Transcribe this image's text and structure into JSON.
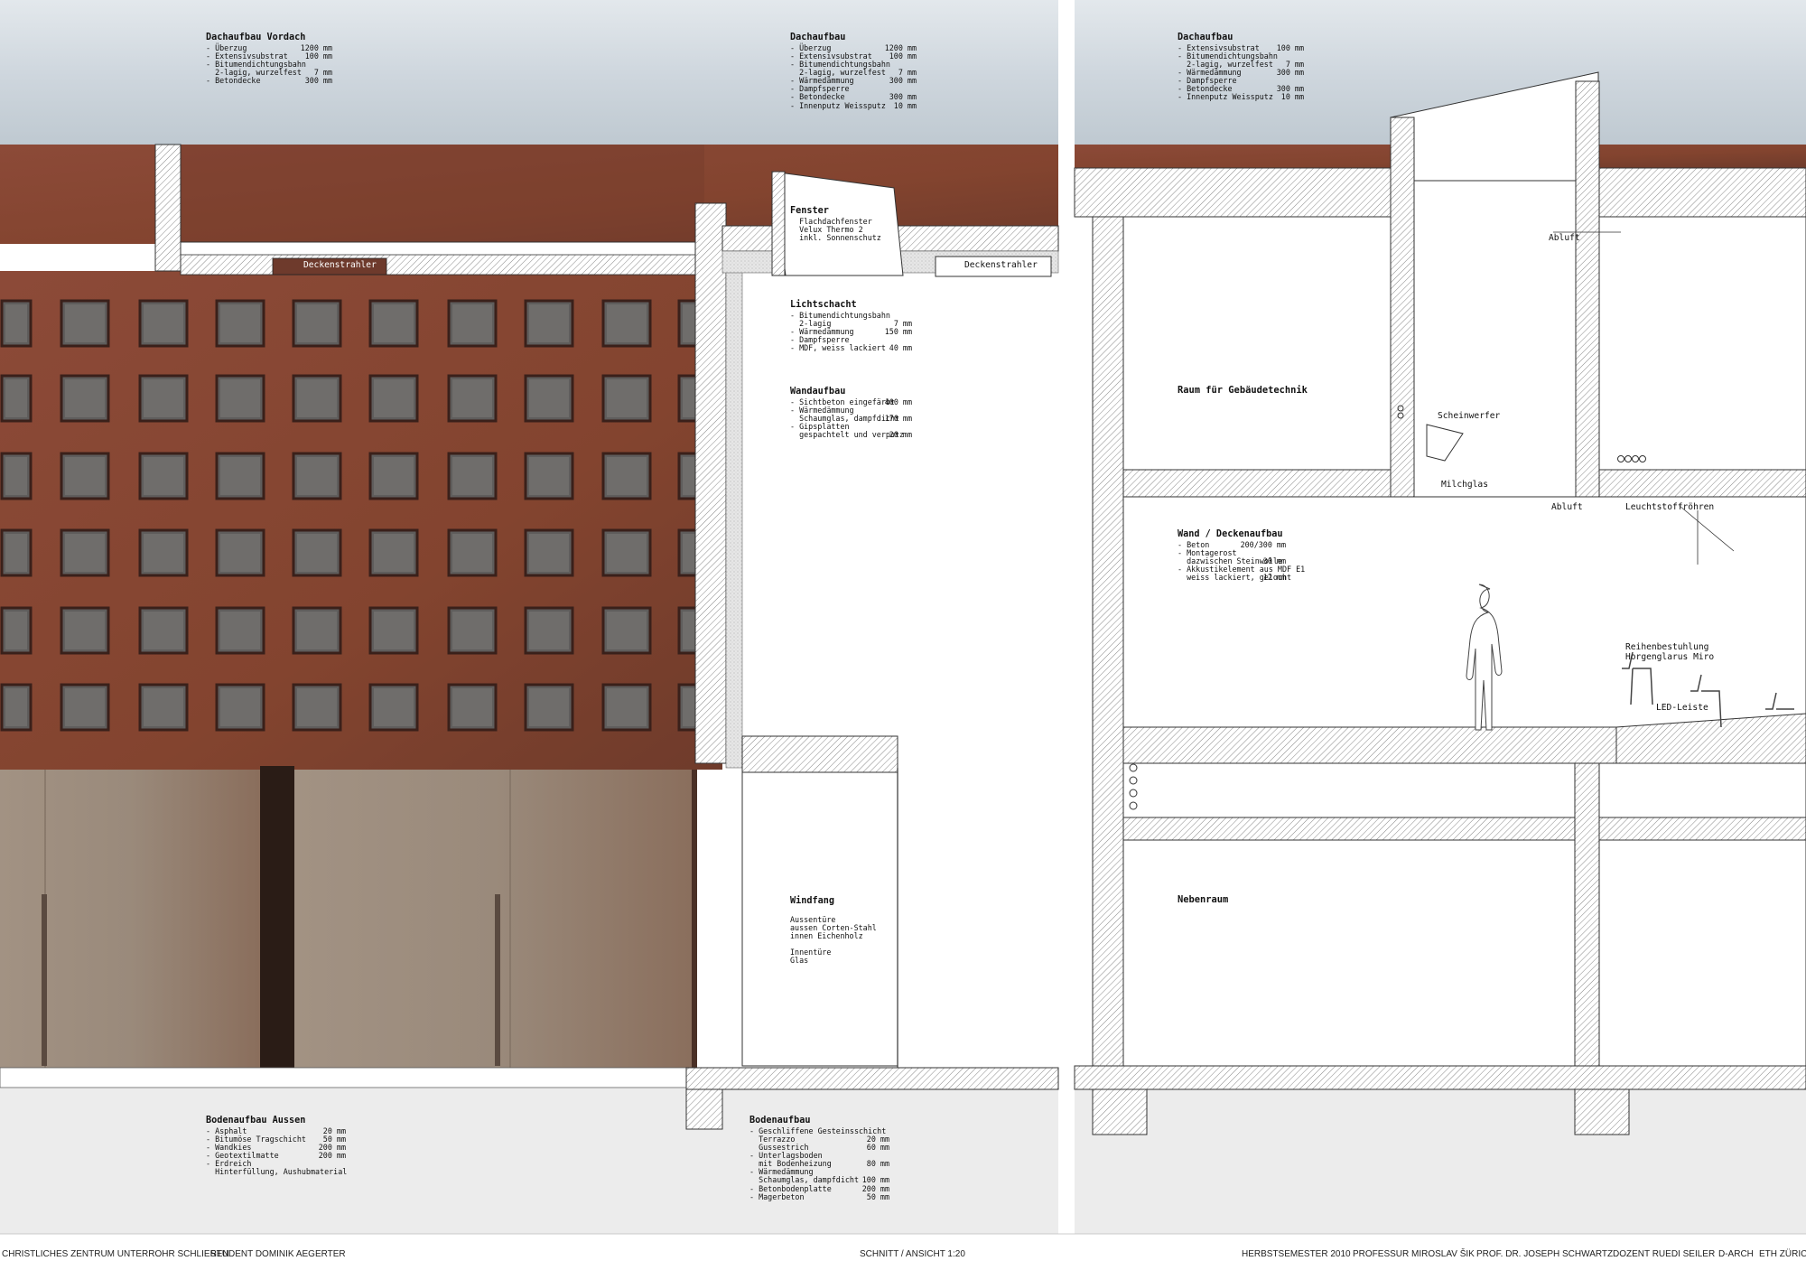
{
  "notes": {
    "dach_vordach": {
      "title": "Dachaufbau Vordach",
      "lines": [
        [
          "- Überzug",
          "1200 mm"
        ],
        [
          "- Extensivsubstrat",
          "100 mm"
        ],
        [
          "- Bitumendichtungsbahn",
          ""
        ],
        [
          "  2-lagig, wurzelfest",
          "7 mm"
        ],
        [
          "- Betondecke",
          "300 mm"
        ]
      ]
    },
    "dach_mitte": {
      "title": "Dachaufbau",
      "lines": [
        [
          "- Überzug",
          "1200 mm"
        ],
        [
          "- Extensivsubstrat",
          "100 mm"
        ],
        [
          "- Bitumendichtungsbahn",
          ""
        ],
        [
          "  2-lagig, wurzelfest",
          "7 mm"
        ],
        [
          "- Wärmedämmung",
          "300 mm"
        ],
        [
          "- Dampfsperre",
          ""
        ],
        [
          "- Betondecke",
          "300 mm"
        ],
        [
          "- Innenputz Weissputz",
          "10 mm"
        ]
      ]
    },
    "dach_rechts": {
      "title": "Dachaufbau",
      "lines": [
        [
          "- Extensivsubstrat",
          "100 mm"
        ],
        [
          "- Bitumendichtungsbahn",
          ""
        ],
        [
          "  2-lagig, wurzelfest",
          "7 mm"
        ],
        [
          "- Wärmedämmung",
          "300 mm"
        ],
        [
          "- Dampfsperre",
          ""
        ],
        [
          "- Betondecke",
          "300 mm"
        ],
        [
          "- Innenputz Weissputz",
          "10 mm"
        ]
      ]
    },
    "fenster": {
      "title": "Fenster",
      "lines": [
        [
          "  Flachdachfenster",
          ""
        ],
        [
          "  Velux Thermo 2",
          ""
        ],
        [
          "  inkl. Sonnenschutz",
          ""
        ]
      ]
    },
    "lichtschacht": {
      "title": "Lichtschacht",
      "lines": [
        [
          "- Bitumendichtungsbahn",
          ""
        ],
        [
          "  2-lagig",
          "7 mm"
        ],
        [
          "- Wärmedämmung",
          "150 mm"
        ],
        [
          "- Dampfsperre",
          ""
        ],
        [
          "- MDF, weiss lackiert",
          "40 mm"
        ]
      ]
    },
    "wandaufbau": {
      "title": "Wandaufbau",
      "lines": [
        [
          "- Sichtbeton eingefärbt",
          "400 mm"
        ],
        [
          "- Wärmedämmung",
          ""
        ],
        [
          "  Schaumglas, dampfdicht",
          "170 mm"
        ],
        [
          "- Gipsplatten",
          ""
        ],
        [
          "  gespachtelt und verputz",
          "20 mm"
        ]
      ]
    },
    "wand_decke": {
      "title": "Wand / Deckenaufbau",
      "lines": [
        [
          "- Beton",
          "200/300 mm"
        ],
        [
          "- Montagerost",
          ""
        ],
        [
          "  dazwischen Steinwolle",
          "30 mm"
        ],
        [
          "- Akkustikelement aus MDF E1",
          ""
        ],
        [
          "  weiss lackiert, gelocht",
          "12 mm"
        ]
      ]
    },
    "boden_aussen": {
      "title": "Bodenaufbau Aussen",
      "lines": [
        [
          "- Asphalt",
          "20 mm"
        ],
        [
          "- Bitumöse Tragschicht",
          "50 mm"
        ],
        [
          "- Wandkies",
          "200 mm"
        ],
        [
          "- Geotextilmatte",
          "200 mm"
        ],
        [
          "- Erdreich",
          ""
        ],
        [
          "  Hinterfüllung, Aushubmaterial",
          ""
        ]
      ]
    },
    "boden": {
      "title": "Bodenaufbau",
      "lines": [
        [
          "- Geschliffene Gesteinsschicht",
          ""
        ],
        [
          "  Terrazzo",
          "20 mm"
        ],
        [
          "  Gussestrich",
          "60 mm"
        ],
        [
          "- Unterlagsboden",
          ""
        ],
        [
          "  mit Bodenheizung",
          "80 mm"
        ],
        [
          "- Wärmedämmung",
          ""
        ],
        [
          "  Schaumglas, dampfdicht",
          "100 mm"
        ],
        [
          "- Betonbodenplatte",
          "200 mm"
        ],
        [
          "- Magerbeton",
          "50 mm"
        ]
      ]
    },
    "windfang": {
      "title": "Windfang",
      "lines": [
        [
          "",
          ""
        ],
        [
          "Aussentüre",
          ""
        ],
        [
          "aussen Corten-Stahl",
          ""
        ],
        [
          "innen Eichenholz",
          ""
        ],
        [
          "",
          ""
        ],
        [
          "Innentüre",
          ""
        ],
        [
          "Glas",
          ""
        ]
      ]
    }
  },
  "labels": {
    "deckenstrahler_1": "Deckenstrahler",
    "deckenstrahler_2": "Deckenstrahler",
    "raum_gebaeudetechnik": "Raum für Gebäudetechnik",
    "nebenraum": "Nebenraum",
    "abluft_1": "Abluft",
    "abluft_2": "Abluft",
    "scheinwerfer": "Scheinwerfer",
    "milchglas": "Milchglas",
    "leuchtstoffroehren": "Leuchtstoffröhren",
    "reihenbestuhlung": "Reihenbestuhlung\nHorgenglarus Miro",
    "led_leiste": "LED-Leiste"
  },
  "footer": {
    "project": "CHRISTLICHES ZENTRUM UNTERROHR SCHLIEREN",
    "student": "STUDENT DOMINIK AEGERTER",
    "drawing": "SCHNITT / ANSICHT 1:20",
    "semester": "HERBSTSEMESTER 2010",
    "prof1": "PROFESSUR MIROSLAV ŠIK",
    "prof2": "PROF. DR. JOSEPH SCHWARTZ",
    "dozent": "DOZENT RUEDI SEILER",
    "dept": "D-ARCH",
    "school": "ETH ZÜRICH"
  },
  "colors": {
    "brick": "#8a4a38",
    "brick_dark": "#6e3a2c",
    "glass": "#6c6a68",
    "door": "#9c8c7e",
    "sky": "#d6dde3",
    "ground": "#ebebeb"
  }
}
